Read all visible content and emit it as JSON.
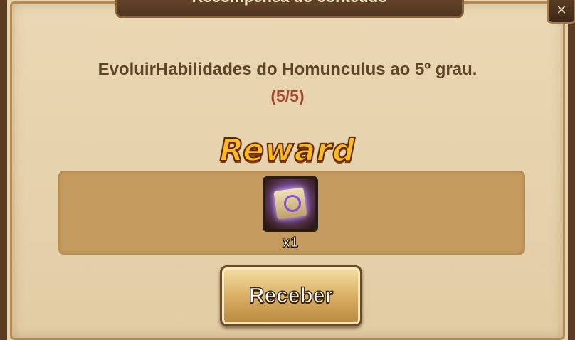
{
  "dialog": {
    "title": "Recompensa do conteúdo",
    "description": "EvoluirHabilidades do Homunculus ao 5º grau.",
    "progress": "(5/5)",
    "close_icon": "close-icon"
  },
  "reward": {
    "heading": "Reward",
    "items": [
      {
        "icon": "enchant-scroll-icon",
        "quantity": "x1"
      }
    ]
  },
  "actions": {
    "receive_label": "Receber"
  },
  "colors": {
    "accent_top": "#d1462a",
    "progress_text": "#a3482e",
    "reward_heading": "#ffb820"
  }
}
